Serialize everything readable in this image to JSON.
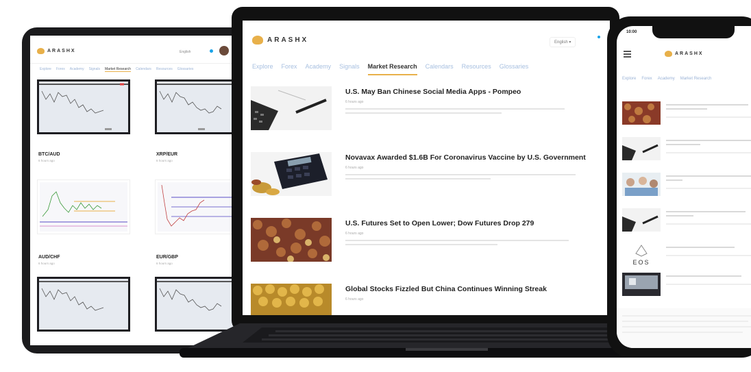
{
  "tablet": {
    "brand": "ARASHX",
    "language": "English",
    "nav": [
      "Explore",
      "Forex",
      "Academy",
      "Signals",
      "Market Research",
      "Calendars",
      "Resources",
      "Glossaries"
    ],
    "active_nav_index": 4,
    "charts": [
      {
        "pair": "BTC/AUD",
        "sub": "6 hours ago"
      },
      {
        "pair": "XRP/EUR",
        "sub": "6 hours ago"
      },
      {
        "pair": "AUD/CHF",
        "sub": "6 hours ago"
      },
      {
        "pair": "EUR/GBP",
        "sub": "6 hours ago"
      },
      {
        "pair": "",
        "sub": ""
      },
      {
        "pair": "",
        "sub": ""
      }
    ]
  },
  "laptop": {
    "brand": "ARASHX",
    "language": "English",
    "nav": [
      "Explore",
      "Forex",
      "Academy",
      "Signals",
      "Market Research",
      "Calendars",
      "Resources",
      "Glossaries"
    ],
    "active_nav_index": 4,
    "news": [
      {
        "title": "U.S. May Ban Chinese Social Media Apps - Pompeo",
        "meta": "6 hours ago"
      },
      {
        "title": "Novavax Awarded $1.6B For Coronavirus Vaccine by U.S. Government",
        "meta": "6 hours ago"
      },
      {
        "title": "U.S. Futures Set to Open Lower; Dow Futures Drop 279",
        "meta": "6 hours ago"
      },
      {
        "title": "Global Stocks Fizzled But China Continues Winning Streak",
        "meta": "6 hours ago"
      }
    ]
  },
  "phone": {
    "time": "10:00",
    "brand": "ARASHX",
    "nav": [
      "Explore",
      "Forex",
      "Academy",
      "Market Research"
    ],
    "eos_label": "EOS"
  },
  "colors": {
    "accent": "#e8b04a",
    "nav_inactive": "#a8c0e0",
    "device_frame": "#111111",
    "dot_blue": "#1aa3e8"
  }
}
